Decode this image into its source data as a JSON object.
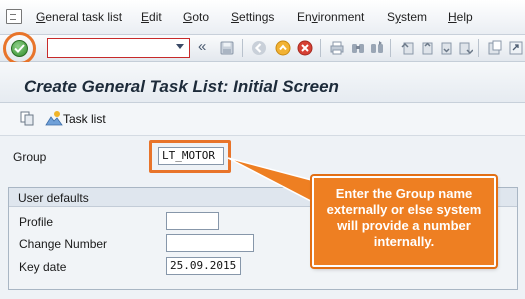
{
  "menubar": {
    "items": [
      {
        "label": "General task list",
        "underline": "G"
      },
      {
        "label": "Edit",
        "underline": "E"
      },
      {
        "label": "Goto",
        "underline": "G"
      },
      {
        "label": "Settings",
        "underline": "S"
      },
      {
        "label": "Environment",
        "underline": "v"
      },
      {
        "label": "System",
        "underline": "y"
      },
      {
        "label": "Help",
        "underline": "H"
      }
    ]
  },
  "toolbar": {
    "command_field_value": "",
    "enter_icon": "checkmark-icon",
    "back_glyph": "«"
  },
  "page": {
    "title": "Create General Task List: Initial Screen"
  },
  "app_toolbar": {
    "task_list_label": "Task list"
  },
  "form": {
    "group_label": "Group",
    "group_value": "LT_MOTOR",
    "section_title": "User defaults",
    "profile_label": "Profile",
    "profile_value": "",
    "change_number_label": "Change Number",
    "change_number_value": "",
    "key_date_label": "Key date",
    "key_date_value": "25.09.2015"
  },
  "callout": {
    "text": "Enter the Group name externally or else system will provide a number internally."
  },
  "colors": {
    "accent_orange": "#ee7f22",
    "title_text": "#1d2b3a",
    "command_border": "#c72a2a"
  }
}
